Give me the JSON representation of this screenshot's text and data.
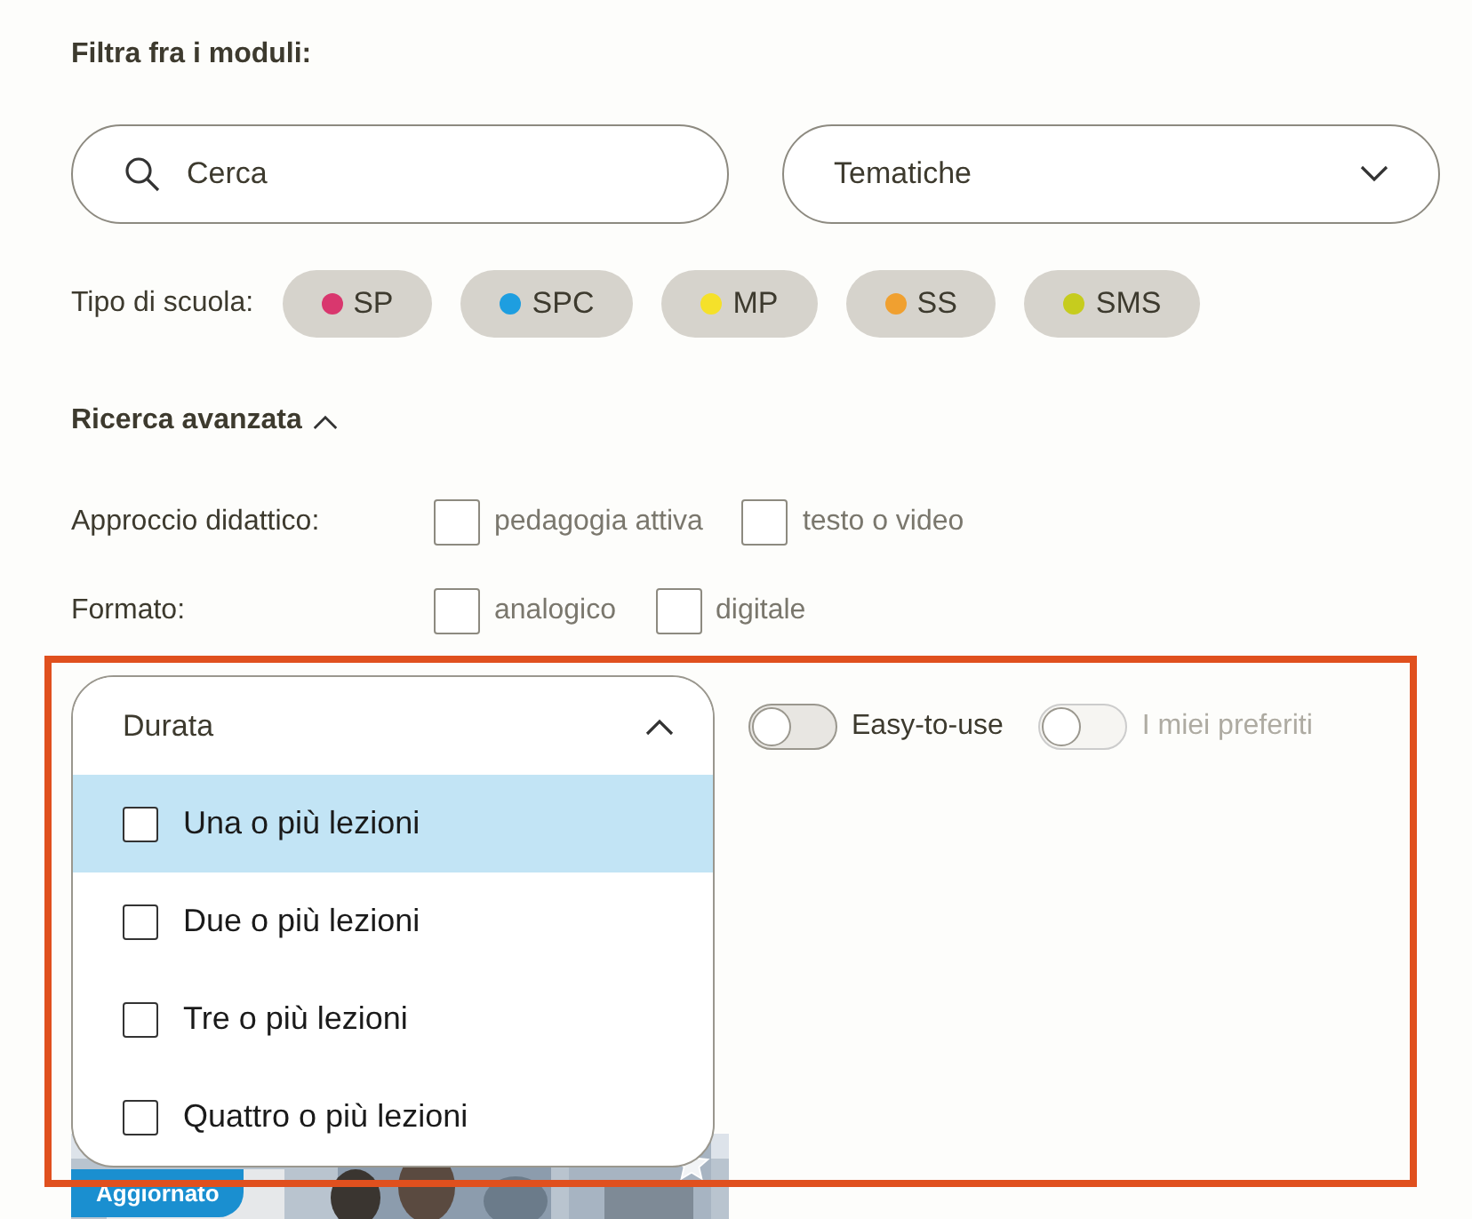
{
  "heading": "Filtra fra i moduli:",
  "search": {
    "placeholder": "Cerca"
  },
  "topics": {
    "label": "Tematiche",
    "expanded": false
  },
  "school_type": {
    "label": "Tipo di scuola:",
    "chips": [
      {
        "label": "SP",
        "color": "#d9376e",
        "selected": false
      },
      {
        "label": "SPC",
        "color": "#1e9ee0",
        "selected": false
      },
      {
        "label": "MP",
        "color": "#f5e12a",
        "selected": false
      },
      {
        "label": "SS",
        "color": "#f0a030",
        "selected": false
      },
      {
        "label": "SMS",
        "color": "#c6cc1e",
        "selected": false
      }
    ]
  },
  "advanced": {
    "label": "Ricerca avanzata",
    "expanded": true
  },
  "filters": [
    {
      "label": "Approccio didattico:",
      "options": [
        {
          "label": "pedagogia attiva",
          "checked": false
        },
        {
          "label": "testo o video",
          "checked": false
        }
      ]
    },
    {
      "label": "Formato:",
      "options": [
        {
          "label": "analogico",
          "checked": false
        },
        {
          "label": "digitale",
          "checked": false
        }
      ]
    }
  ],
  "duration": {
    "label": "Durata",
    "expanded": true,
    "options": [
      {
        "label": "Una o più lezioni",
        "checked": false,
        "highlighted": true
      },
      {
        "label": "Due o più lezioni",
        "checked": false,
        "highlighted": false
      },
      {
        "label": "Tre o più lezioni",
        "checked": false,
        "highlighted": false
      },
      {
        "label": "Quattro o più lezioni",
        "checked": false,
        "highlighted": false
      }
    ]
  },
  "toggles": [
    {
      "label": "Easy-to-use",
      "on": false,
      "disabled": false
    },
    {
      "label": "I miei preferiti",
      "on": false,
      "disabled": true
    }
  ],
  "card": {
    "badge": "Aggiornato"
  }
}
